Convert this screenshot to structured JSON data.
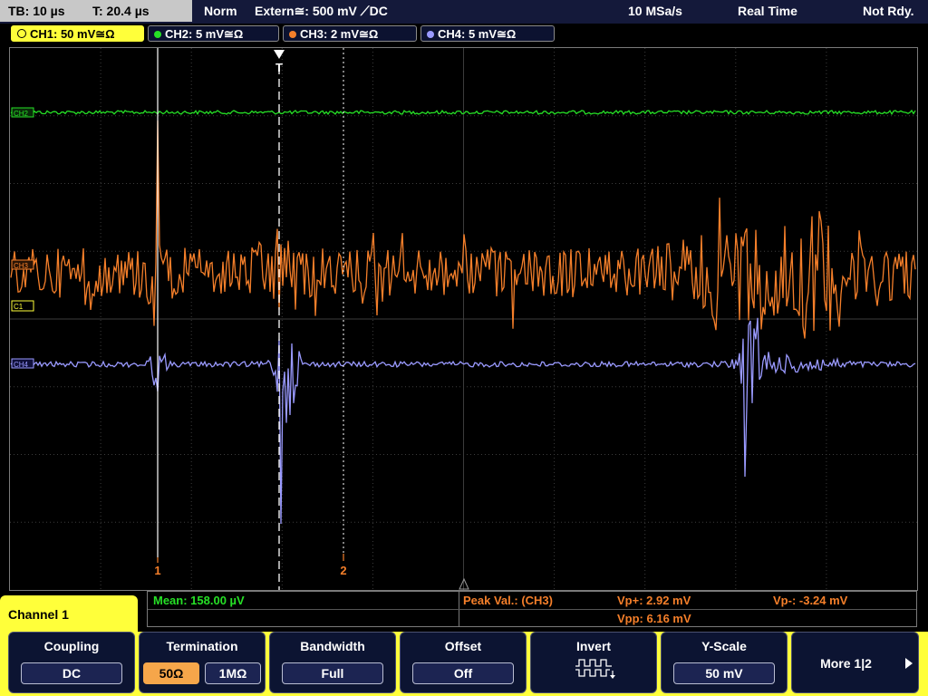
{
  "top_bar": {
    "timebase": "TB: 10 µs",
    "trigger_time": "T: 20.4 µs",
    "trigger_mode": "Norm",
    "trigger_source": "Extern≅: 500 mV ⟋DC",
    "sample_rate": "10 MSa/s",
    "acquisition_mode": "Real Time",
    "status": "Not Rdy."
  },
  "channel_tabs": [
    {
      "label": "CH1: 50 mV≅Ω",
      "color": "#ffff3a",
      "active": true
    },
    {
      "label": "CH2: 5 mV≅Ω",
      "color": "#26e026"
    },
    {
      "label": "CH3: 2 mV≅Ω",
      "color": "#f57f2a"
    },
    {
      "label": "CH4: 5 mV≅Ω",
      "color": "#9a9aff"
    }
  ],
  "markers": {
    "channel_ch2": "CH2",
    "channel_ch3": "CH3",
    "channel_ch1": "C1",
    "channel_ch4": "CH4",
    "trigger": "T",
    "cursor1": "1",
    "cursor2": "2"
  },
  "measurements": {
    "mean": "Mean: 158.00 µV",
    "peak_label": "Peak Val.:  (CH3)",
    "vp_plus": "Vp+: 2.92 mV",
    "vp_minus": "Vp-: -3.24 mV",
    "vpp": "Vpp: 6.16 mV"
  },
  "menu": {
    "channel_title": "Channel 1",
    "coupling": {
      "title": "Coupling",
      "value": "DC"
    },
    "termination": {
      "title": "Termination",
      "option_50": "50Ω",
      "option_1m": "1MΩ",
      "selected": "50Ω"
    },
    "bandwidth": {
      "title": "Bandwidth",
      "value": "Full"
    },
    "offset": {
      "title": "Offset",
      "value": "Off"
    },
    "invert": {
      "title": "Invert"
    },
    "yscale": {
      "title": "Y-Scale",
      "value": "50 mV"
    },
    "more": {
      "label": "More 1|2"
    }
  },
  "colors": {
    "ch1": "#ffff3a",
    "ch2": "#26e026",
    "ch3": "#f57f2a",
    "ch4": "#9a9aff",
    "grid": "#3c3c3c"
  }
}
